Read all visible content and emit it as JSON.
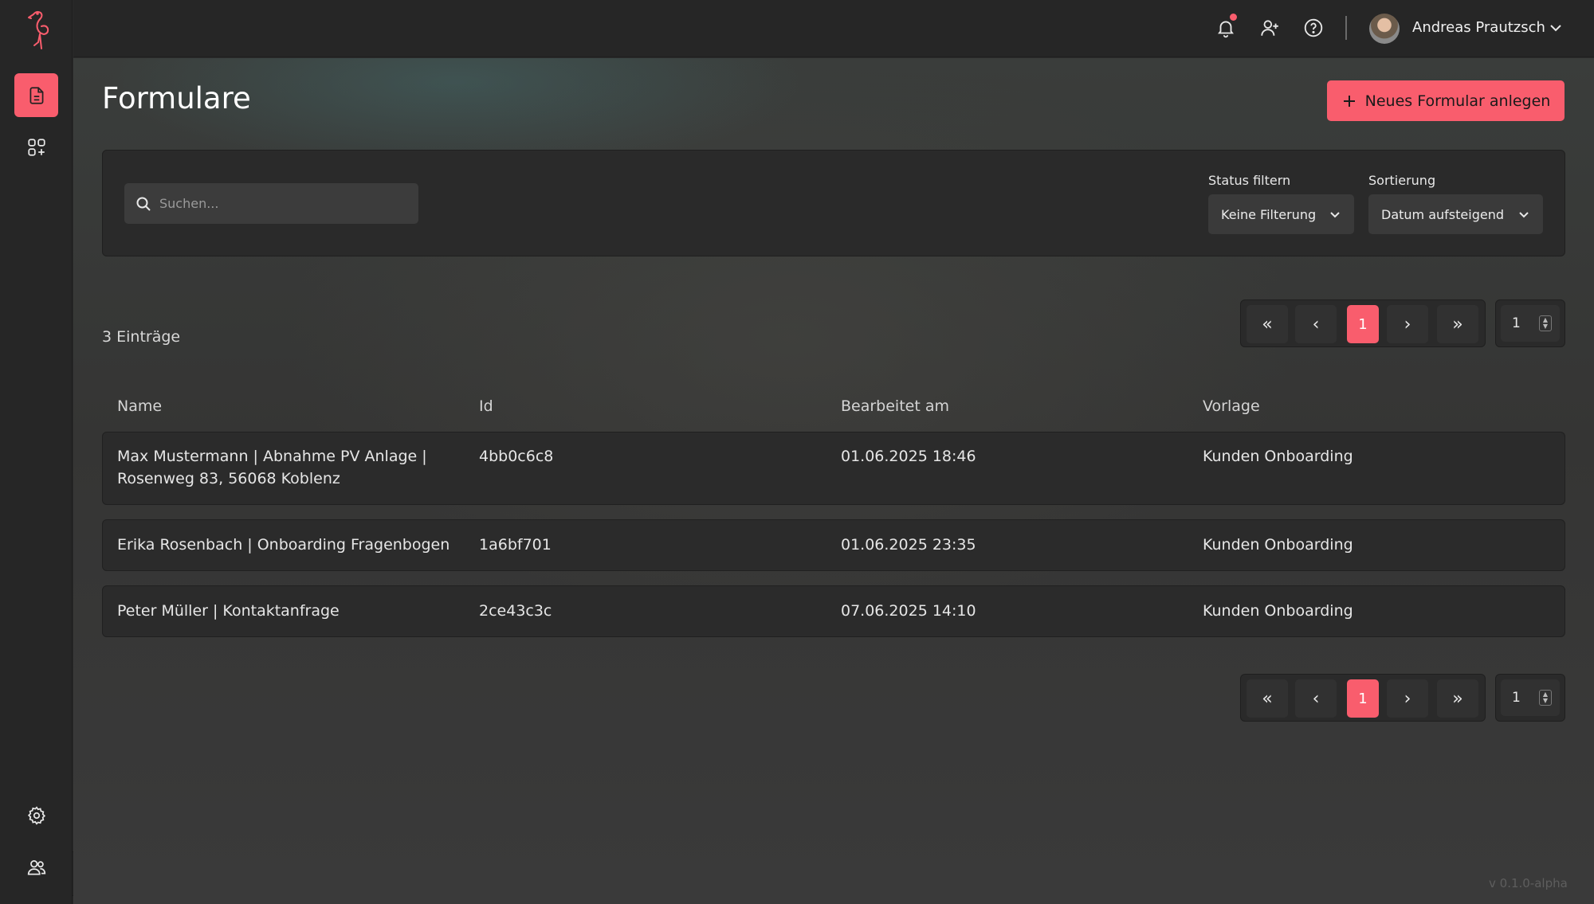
{
  "app": {
    "version": "v 0.1.0-alpha"
  },
  "colors": {
    "accent": "#f95d6d",
    "background": "#2b2b2b",
    "sidebar": "#262626"
  },
  "sidebar": {
    "items": [
      {
        "name": "forms",
        "icon": "document-icon",
        "active": true
      },
      {
        "name": "apps",
        "icon": "apps-add-icon",
        "active": false
      }
    ],
    "bottom": [
      {
        "name": "settings",
        "icon": "gear-icon"
      },
      {
        "name": "users",
        "icon": "users-icon"
      }
    ]
  },
  "header": {
    "icons": [
      "bell-icon",
      "user-plus-icon",
      "help-icon"
    ],
    "has_notification": true,
    "user": {
      "name": "Andreas Prautzsch"
    }
  },
  "page": {
    "title": "Formulare",
    "new_button_label": "Neues Formular anlegen"
  },
  "filters": {
    "search_placeholder": "Suchen...",
    "status_label": "Status filtern",
    "status_value": "Keine Filterung",
    "sort_label": "Sortierung",
    "sort_value": "Datum aufsteigend"
  },
  "list": {
    "count_text": "3 Einträge",
    "pagination": {
      "current_page": "1",
      "page_size_value": "1",
      "first": "«",
      "prev": "‹",
      "next": "›",
      "last": "»"
    },
    "columns": [
      "Name",
      "Id",
      "Bearbeitet am",
      "Vorlage"
    ],
    "rows": [
      {
        "name_line1": "Max Mustermann | Abnahme PV Anlage |",
        "name_line2": "Rosenweg 83, 56068 Koblenz",
        "id": "4bb0c6c8",
        "edited": "01.06.2025 18:46",
        "template": "Kunden Onboarding"
      },
      {
        "name_line1": "Erika Rosenbach | Onboarding Fragenbogen",
        "name_line2": "",
        "id": "1a6bf701",
        "edited": "01.06.2025 23:35",
        "template": "Kunden Onboarding"
      },
      {
        "name_line1": "Peter Müller | Kontaktanfrage",
        "name_line2": "",
        "id": "2ce43c3c",
        "edited": "07.06.2025 14:10",
        "template": "Kunden Onboarding"
      }
    ]
  }
}
